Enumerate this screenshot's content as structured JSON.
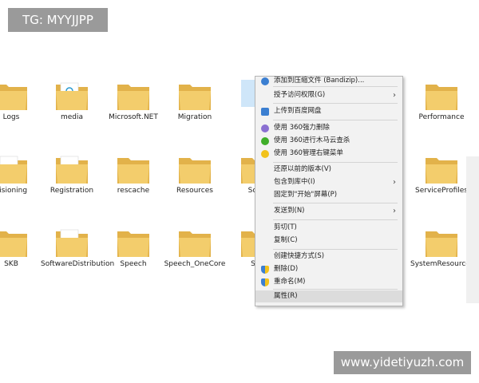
{
  "watermark_top": "TG: MYYJJPP",
  "watermark_bottom": "www.yidetiyuzh.com",
  "folders": [
    {
      "label": "Logs",
      "variant": "plain"
    },
    {
      "label": "media",
      "variant": "media"
    },
    {
      "label": "Microsoft.NET",
      "variant": "plain"
    },
    {
      "label": "Migration",
      "variant": "plain"
    },
    {
      "label": "O",
      "variant": "selected"
    },
    {
      "label": "Performance",
      "variant": "plain"
    },
    {
      "label": "visioning",
      "variant": "docs"
    },
    {
      "label": "Registration",
      "variant": "docs"
    },
    {
      "label": "rescache",
      "variant": "plain"
    },
    {
      "label": "Resources",
      "variant": "plain"
    },
    {
      "label": "SchC",
      "variant": "plain"
    },
    {
      "label": "ServiceProfiles",
      "variant": "plain"
    },
    {
      "label": "SKB",
      "variant": "plain"
    },
    {
      "label": "SoftwareDistribution",
      "variant": "docs"
    },
    {
      "label": "Speech",
      "variant": "plain"
    },
    {
      "label": "Speech_OneCore",
      "variant": "plain"
    },
    {
      "label": "Sys",
      "variant": "plain"
    },
    {
      "label": "SystemResources",
      "variant": "plain"
    }
  ],
  "context_menu": {
    "items": [
      {
        "label": "添加到压缩文件 (Bandizip)...",
        "icon": "bandizip-icon",
        "arrow": false
      },
      {
        "label": "授予访问权限(G)",
        "icon": "",
        "arrow": true
      },
      {
        "label": "上传到百度网盘",
        "icon": "baidu-cloud-icon",
        "arrow": false
      },
      {
        "label": "使用 360强力删除",
        "icon": "360-delete-icon",
        "arrow": false
      },
      {
        "label": "使用 360进行木马云查杀",
        "icon": "360-scan-icon",
        "arrow": false
      },
      {
        "label": "使用 360管理右键菜单",
        "icon": "360-manage-icon",
        "arrow": false
      },
      {
        "label": "还原以前的版本(V)",
        "icon": "",
        "arrow": false
      },
      {
        "label": "包含到库中(I)",
        "icon": "",
        "arrow": true
      },
      {
        "label": "固定到\"开始\"屏幕(P)",
        "icon": "",
        "arrow": false
      },
      {
        "label": "发送到(N)",
        "icon": "",
        "arrow": true
      },
      {
        "label": "剪切(T)",
        "icon": "",
        "arrow": false
      },
      {
        "label": "复制(C)",
        "icon": "",
        "arrow": false
      },
      {
        "label": "创建快捷方式(S)",
        "icon": "",
        "arrow": false
      },
      {
        "label": "删除(D)",
        "icon": "shield-icon",
        "arrow": false
      },
      {
        "label": "重命名(M)",
        "icon": "shield-icon",
        "arrow": false
      },
      {
        "label": "属性(R)",
        "icon": "",
        "arrow": false
      }
    ],
    "arrow_glyph": "›"
  },
  "colors": {
    "folder_body": "#f3cd6c",
    "folder_back": "#e2b24a",
    "menu_bg": "#f2f2f2",
    "highlight": "#dcdcdc",
    "selected_tile": "#cfe6f9",
    "icon_360_green": "#3fae29",
    "icon_360_yellow": "#f2c21b",
    "icon_purple": "#8a6fd1",
    "icon_blue": "#3b7fd1"
  }
}
